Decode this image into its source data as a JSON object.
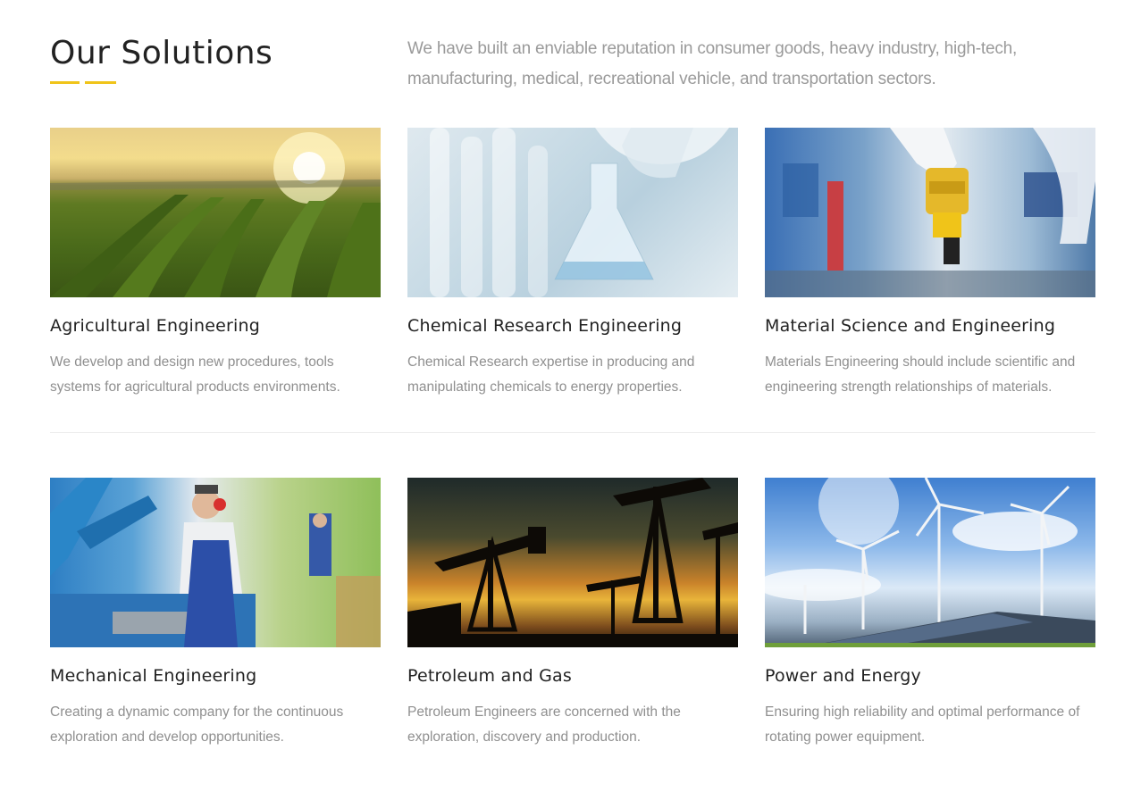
{
  "header": {
    "title": "Our Solutions",
    "intro": "We have built an enviable reputation in consumer goods, heavy industry, high-tech, manufacturing, medical, recreational vehicle, and transportation sectors.",
    "accent_color": "#f0c419"
  },
  "solutions": [
    {
      "title": "Agricultural Engineering",
      "description": "We develop and design new procedures, tools systems for agricultural products environments.",
      "image": "crop-field-sunset"
    },
    {
      "title": "Chemical Research Engineering",
      "description": "Chemical Research expertise in producing and manipulating chemicals to energy properties.",
      "image": "lab-glassware"
    },
    {
      "title": "Material Science and Engineering",
      "description": "Materials Engineering should include scientific and engineering strength relationships of materials.",
      "image": "industrial-robot-arm"
    },
    {
      "title": "Mechanical Engineering",
      "description": "Creating a dynamic company for the continuous exploration and develop opportunities.",
      "image": "factory-worker"
    },
    {
      "title": "Petroleum and Gas",
      "description": "Petroleum Engineers are concerned with the exploration, discovery and production.",
      "image": "oil-pumpjacks-sunset"
    },
    {
      "title": "Power and Energy",
      "description": "Ensuring high reliability and optimal performance of rotating power equipment.",
      "image": "wind-turbines-solar-panels"
    }
  ]
}
